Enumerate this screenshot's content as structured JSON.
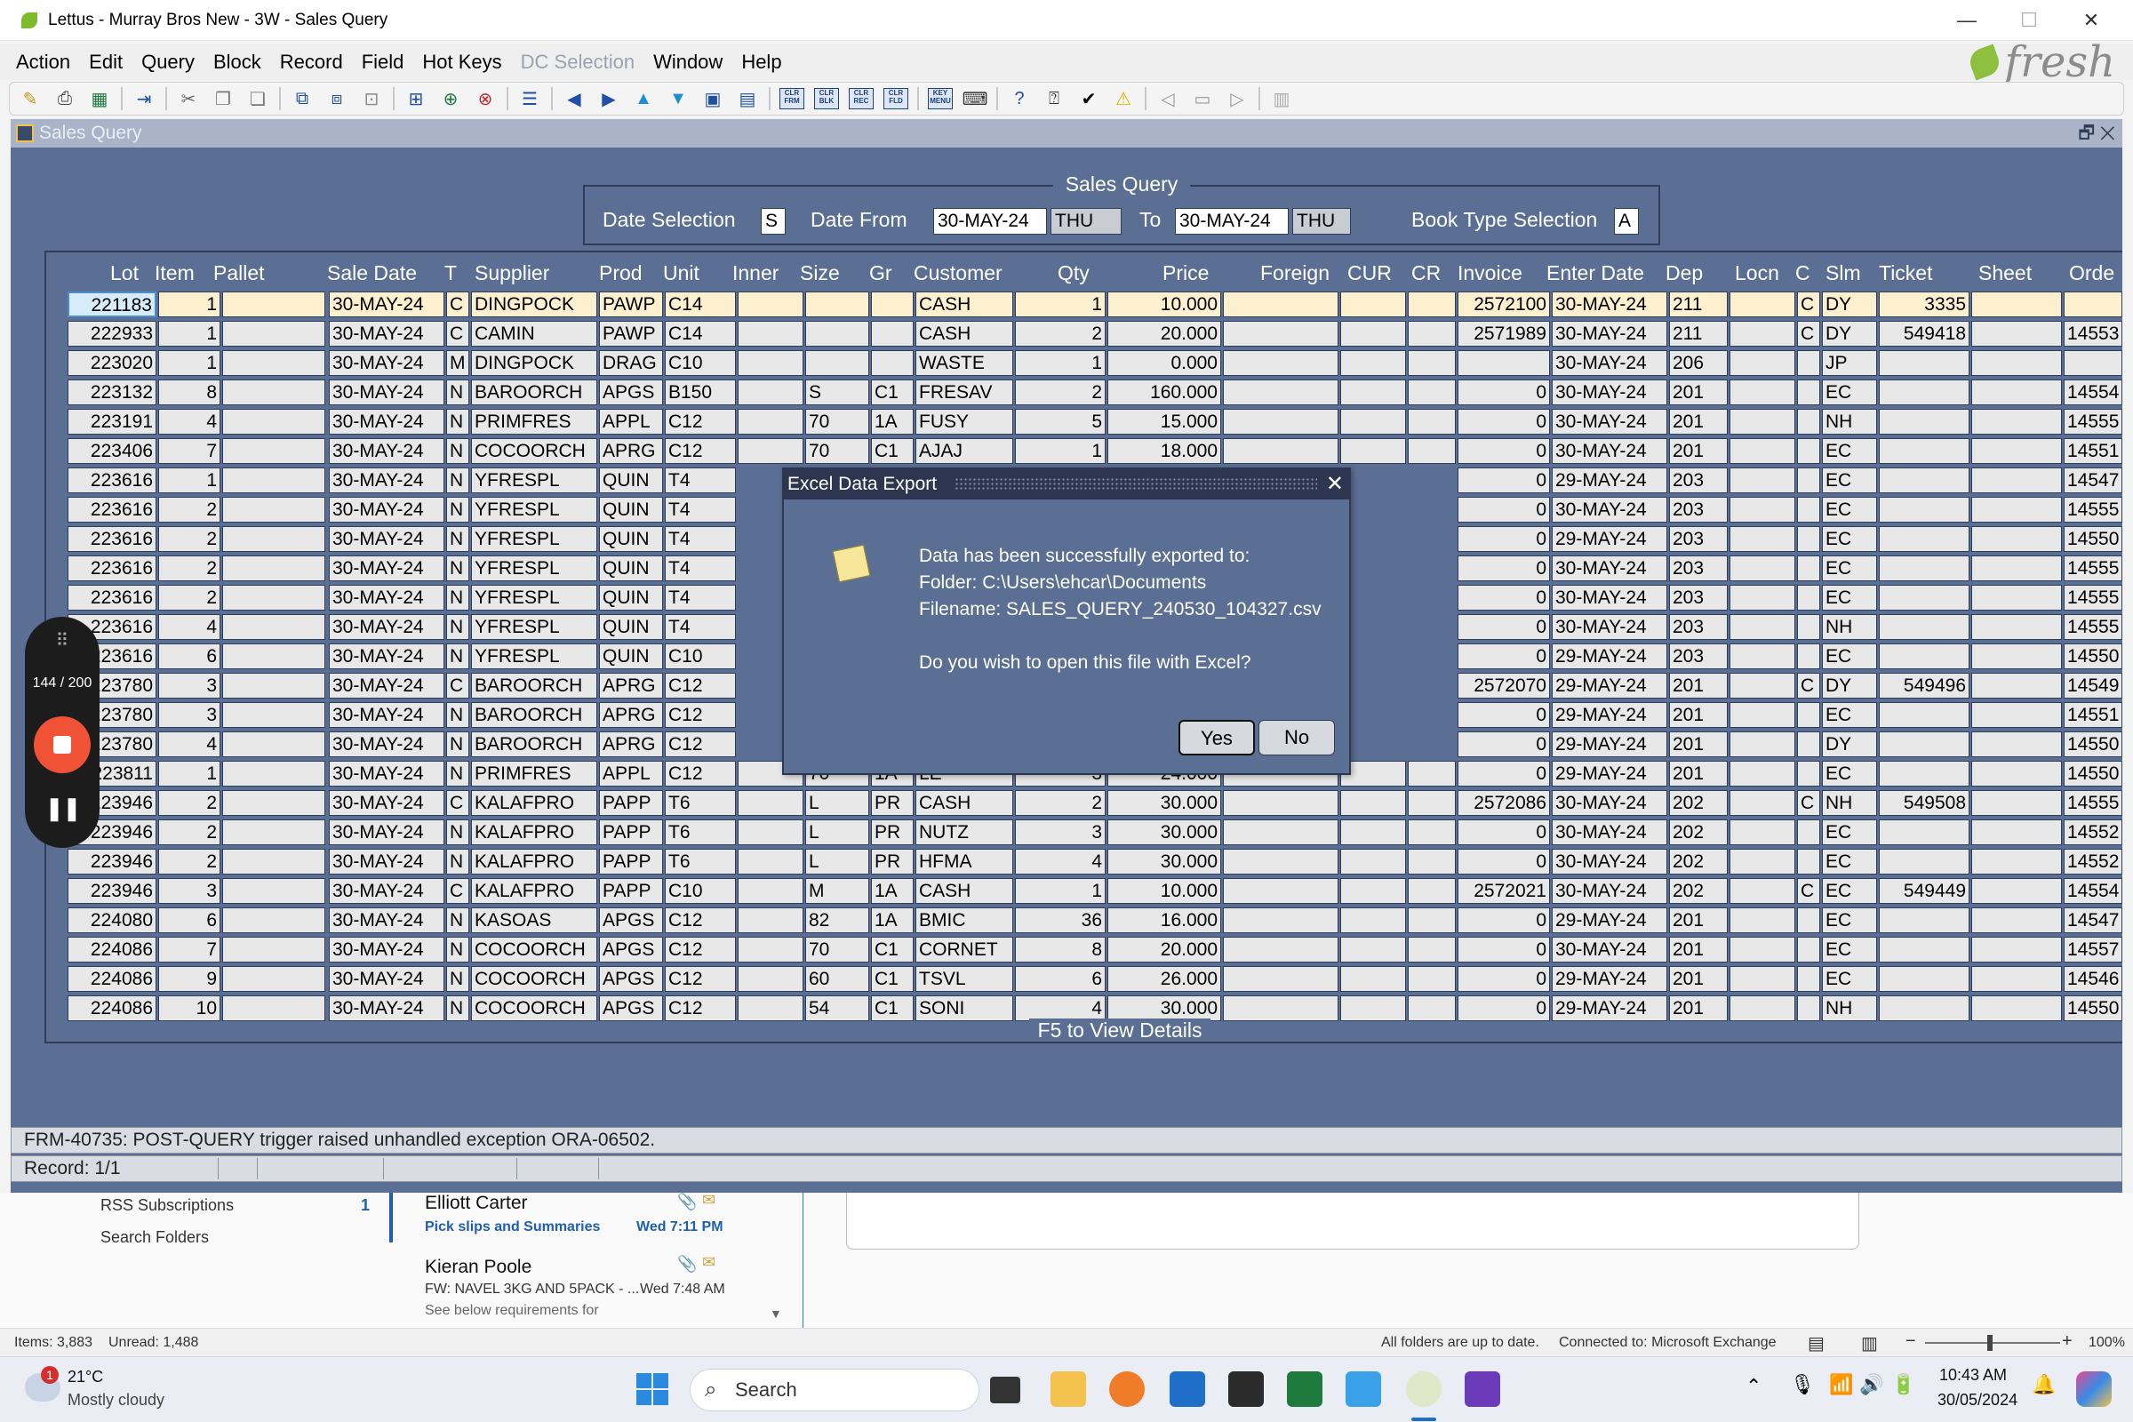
{
  "window": {
    "title": "Lettus - Murray Bros New - 3W - Sales Query",
    "minimize": "—",
    "maximize": "☐",
    "close": "✕"
  },
  "menu": [
    {
      "label": "Action",
      "enabled": true
    },
    {
      "label": "Edit",
      "enabled": true
    },
    {
      "label": "Query",
      "enabled": true
    },
    {
      "label": "Block",
      "enabled": true
    },
    {
      "label": "Record",
      "enabled": true
    },
    {
      "label": "Field",
      "enabled": true
    },
    {
      "label": "Hot Keys",
      "enabled": true
    },
    {
      "label": "DC Selection",
      "enabled": false
    },
    {
      "label": "Window",
      "enabled": true
    },
    {
      "label": "Help",
      "enabled": true
    }
  ],
  "logo": "fresh",
  "toolbar_boxes": [
    "CLR FRM",
    "CLR BLK",
    "CLR REC",
    "CLR FLD",
    "KEY MENU"
  ],
  "form": {
    "title": "Sales Query",
    "header": {
      "caption": "Sales Query",
      "date_selection_label": "Date Selection",
      "date_selection_value": "S",
      "date_from_label": "Date From",
      "date_from_value": "30-MAY-24",
      "date_from_day": "THU",
      "to_label": "To",
      "to_value": "30-MAY-24",
      "to_day": "THU",
      "book_type_label": "Book Type Selection",
      "book_type_value": "A"
    },
    "columns": [
      "Lot",
      "Item",
      "Pallet",
      "Sale Date",
      "T",
      "Supplier",
      "Prod",
      "Unit",
      "Inner",
      "Size",
      "Gr",
      "Customer",
      "Qty",
      "Price",
      "Foreign",
      "CUR",
      "CR",
      "Invoice",
      "Enter Date",
      "Dep",
      "Locn",
      "C",
      "Slm",
      "Ticket",
      "Sheet",
      "Orde"
    ],
    "rows": [
      [
        "221183",
        "1",
        "",
        "30-MAY-24",
        "C",
        "DINGPOCK",
        "PAWP",
        "C14",
        "",
        "",
        "",
        "CASH",
        "1",
        "10.000",
        "",
        "",
        "",
        "2572100",
        "30-MAY-24",
        "211",
        "",
        "C",
        "DY",
        "3335",
        "",
        ""
      ],
      [
        "222933",
        "1",
        "",
        "30-MAY-24",
        "C",
        "CAMIN",
        "PAWP",
        "C14",
        "",
        "",
        "",
        "CASH",
        "2",
        "20.000",
        "",
        "",
        "",
        "2571989",
        "30-MAY-24",
        "211",
        "",
        "C",
        "DY",
        "549418",
        "",
        "14553"
      ],
      [
        "223020",
        "1",
        "",
        "30-MAY-24",
        "M",
        "DINGPOCK",
        "DRAG",
        "C10",
        "",
        "",
        "",
        "WASTE",
        "1",
        "0.000",
        "",
        "",
        "",
        "",
        "30-MAY-24",
        "206",
        "",
        "",
        "JP",
        "",
        "",
        ""
      ],
      [
        "223132",
        "8",
        "",
        "30-MAY-24",
        "N",
        "BAROORCH",
        "APGS",
        "B150",
        "",
        "S",
        "C1",
        "FRESAV",
        "2",
        "160.000",
        "",
        "",
        "",
        "0",
        "30-MAY-24",
        "201",
        "",
        "",
        "EC",
        "",
        "",
        "14554"
      ],
      [
        "223191",
        "4",
        "",
        "30-MAY-24",
        "N",
        "PRIMFRES",
        "APPL",
        "C12",
        "",
        "70",
        "1A",
        "FUSY",
        "5",
        "15.000",
        "",
        "",
        "",
        "0",
        "30-MAY-24",
        "201",
        "",
        "",
        "NH",
        "",
        "",
        "14555"
      ],
      [
        "223406",
        "7",
        "",
        "30-MAY-24",
        "N",
        "COCOORCH",
        "APRG",
        "C12",
        "",
        "70",
        "C1",
        "AJAJ",
        "1",
        "18.000",
        "",
        "",
        "",
        "0",
        "30-MAY-24",
        "201",
        "",
        "",
        "EC",
        "",
        "",
        "14551"
      ],
      [
        "223616",
        "1",
        "",
        "30-MAY-24",
        "N",
        "YFRESPL",
        "QUIN",
        "T4",
        "",
        "",
        "",
        "",
        "",
        "",
        "",
        "",
        "",
        "0",
        "29-MAY-24",
        "203",
        "",
        "",
        "EC",
        "",
        "",
        "14547"
      ],
      [
        "223616",
        "2",
        "",
        "30-MAY-24",
        "N",
        "YFRESPL",
        "QUIN",
        "T4",
        "",
        "",
        "",
        "",
        "",
        "",
        "",
        "",
        "",
        "0",
        "30-MAY-24",
        "203",
        "",
        "",
        "EC",
        "",
        "",
        "14555"
      ],
      [
        "223616",
        "2",
        "",
        "30-MAY-24",
        "N",
        "YFRESPL",
        "QUIN",
        "T4",
        "",
        "",
        "",
        "",
        "",
        "",
        "",
        "",
        "",
        "0",
        "29-MAY-24",
        "203",
        "",
        "",
        "EC",
        "",
        "",
        "14550"
      ],
      [
        "223616",
        "2",
        "",
        "30-MAY-24",
        "N",
        "YFRESPL",
        "QUIN",
        "T4",
        "",
        "",
        "",
        "",
        "",
        "",
        "",
        "",
        "",
        "0",
        "30-MAY-24",
        "203",
        "",
        "",
        "EC",
        "",
        "",
        "14555"
      ],
      [
        "223616",
        "2",
        "",
        "30-MAY-24",
        "N",
        "YFRESPL",
        "QUIN",
        "T4",
        "",
        "",
        "",
        "",
        "",
        "",
        "",
        "",
        "",
        "0",
        "30-MAY-24",
        "203",
        "",
        "",
        "EC",
        "",
        "",
        "14555"
      ],
      [
        "223616",
        "4",
        "",
        "30-MAY-24",
        "N",
        "YFRESPL",
        "QUIN",
        "T4",
        "",
        "",
        "",
        "",
        "",
        "",
        "",
        "",
        "",
        "0",
        "30-MAY-24",
        "203",
        "",
        "",
        "NH",
        "",
        "",
        "14555"
      ],
      [
        "223616",
        "6",
        "",
        "30-MAY-24",
        "N",
        "YFRESPL",
        "QUIN",
        "C10",
        "",
        "",
        "",
        "",
        "",
        "",
        "",
        "",
        "",
        "0",
        "29-MAY-24",
        "203",
        "",
        "",
        "EC",
        "",
        "",
        "14550"
      ],
      [
        "223780",
        "3",
        "",
        "30-MAY-24",
        "C",
        "BAROORCH",
        "APRG",
        "C12",
        "",
        "",
        "",
        "",
        "",
        "",
        "",
        "",
        "",
        "2572070",
        "29-MAY-24",
        "201",
        "",
        "C",
        "DY",
        "549496",
        "",
        "14549"
      ],
      [
        "223780",
        "3",
        "",
        "30-MAY-24",
        "N",
        "BAROORCH",
        "APRG",
        "C12",
        "",
        "",
        "",
        "",
        "",
        "",
        "",
        "",
        "",
        "0",
        "29-MAY-24",
        "201",
        "",
        "",
        "EC",
        "",
        "",
        "14551"
      ],
      [
        "223780",
        "4",
        "",
        "30-MAY-24",
        "N",
        "BAROORCH",
        "APRG",
        "C12",
        "",
        "",
        "",
        "",
        "",
        "",
        "",
        "",
        "",
        "0",
        "29-MAY-24",
        "201",
        "",
        "",
        "DY",
        "",
        "",
        "14550"
      ],
      [
        "223811",
        "1",
        "",
        "30-MAY-24",
        "N",
        "PRIMFRES",
        "APPL",
        "C12",
        "",
        "70",
        "1A",
        "LE",
        "3",
        "24.000",
        "",
        "",
        "",
        "0",
        "29-MAY-24",
        "201",
        "",
        "",
        "EC",
        "",
        "",
        "14550"
      ],
      [
        "223946",
        "2",
        "",
        "30-MAY-24",
        "C",
        "KALAFPRO",
        "PAPP",
        "T6",
        "",
        "L",
        "PR",
        "CASH",
        "2",
        "30.000",
        "",
        "",
        "",
        "2572086",
        "30-MAY-24",
        "202",
        "",
        "C",
        "NH",
        "549508",
        "",
        "14555"
      ],
      [
        "223946",
        "2",
        "",
        "30-MAY-24",
        "N",
        "KALAFPRO",
        "PAPP",
        "T6",
        "",
        "L",
        "PR",
        "NUTZ",
        "3",
        "30.000",
        "",
        "",
        "",
        "0",
        "30-MAY-24",
        "202",
        "",
        "",
        "EC",
        "",
        "",
        "14552"
      ],
      [
        "223946",
        "2",
        "",
        "30-MAY-24",
        "N",
        "KALAFPRO",
        "PAPP",
        "T6",
        "",
        "L",
        "PR",
        "HFMA",
        "4",
        "30.000",
        "",
        "",
        "",
        "0",
        "30-MAY-24",
        "202",
        "",
        "",
        "EC",
        "",
        "",
        "14552"
      ],
      [
        "223946",
        "3",
        "",
        "30-MAY-24",
        "C",
        "KALAFPRO",
        "PAPP",
        "C10",
        "",
        "M",
        "1A",
        "CASH",
        "1",
        "10.000",
        "",
        "",
        "",
        "2572021",
        "30-MAY-24",
        "202",
        "",
        "C",
        "EC",
        "549449",
        "",
        "14554"
      ],
      [
        "224080",
        "6",
        "",
        "30-MAY-24",
        "N",
        "KASOAS",
        "APGS",
        "C12",
        "",
        "82",
        "1A",
        "BMIC",
        "36",
        "16.000",
        "",
        "",
        "",
        "0",
        "29-MAY-24",
        "201",
        "",
        "",
        "EC",
        "",
        "",
        "14547"
      ],
      [
        "224086",
        "7",
        "",
        "30-MAY-24",
        "N",
        "COCOORCH",
        "APGS",
        "C12",
        "",
        "70",
        "C1",
        "CORNET",
        "8",
        "20.000",
        "",
        "",
        "",
        "0",
        "30-MAY-24",
        "201",
        "",
        "",
        "EC",
        "",
        "",
        "14557"
      ],
      [
        "224086",
        "9",
        "",
        "30-MAY-24",
        "N",
        "COCOORCH",
        "APGS",
        "C12",
        "",
        "60",
        "C1",
        "TSVL",
        "6",
        "26.000",
        "",
        "",
        "",
        "0",
        "29-MAY-24",
        "201",
        "",
        "",
        "EC",
        "",
        "",
        "14546"
      ],
      [
        "224086",
        "10",
        "",
        "30-MAY-24",
        "N",
        "COCOORCH",
        "APGS",
        "C12",
        "",
        "54",
        "C1",
        "SONI",
        "4",
        "30.000",
        "",
        "",
        "",
        "0",
        "29-MAY-24",
        "201",
        "",
        "",
        "NH",
        "",
        "",
        "14550"
      ]
    ],
    "footer_caption": "F5 to View Details"
  },
  "dialog": {
    "title": "Excel Data Export",
    "line1": "Data has been successfully exported to:",
    "line2": "Folder: C:\\Users\\ehcar\\Documents",
    "line3": "Filename: SALES_QUERY_240530_104327.csv",
    "question": "Do you wish to open this file with Excel?",
    "yes": "Yes",
    "no": "No",
    "close": "✕"
  },
  "status": {
    "message": "FRM-40735: POST-QUERY trigger raised unhandled exception ORA-06502.",
    "record": "Record: 1/1"
  },
  "recorder": {
    "count": "144 / 200"
  },
  "outlook": {
    "folders": [
      {
        "label": "RSS Subscriptions",
        "count": "1"
      },
      {
        "label": "Search Folders",
        "count": ""
      }
    ],
    "mails": [
      {
        "from": "Elliott Carter",
        "subject": "Pick slips and Summaries",
        "time": "Wed 7:11 PM",
        "preview": ""
      },
      {
        "from": "Kieran Poole",
        "subject": "FW: NAVEL 3KG AND 5PACK - ...",
        "time": "Wed 7:48 AM",
        "preview": "See below requirements for"
      }
    ],
    "status_items": "Items: 3,883",
    "status_unread": "Unread: 1,488",
    "status_sync": "All folders are up to date.",
    "status_conn": "Connected to: Microsoft Exchange",
    "zoom": "100%"
  },
  "taskbar": {
    "weather_temp": "21°C",
    "weather_desc": "Mostly cloudy",
    "weather_badge": "1",
    "search_placeholder": "Search",
    "time": "10:43 AM",
    "date": "30/05/2024"
  }
}
